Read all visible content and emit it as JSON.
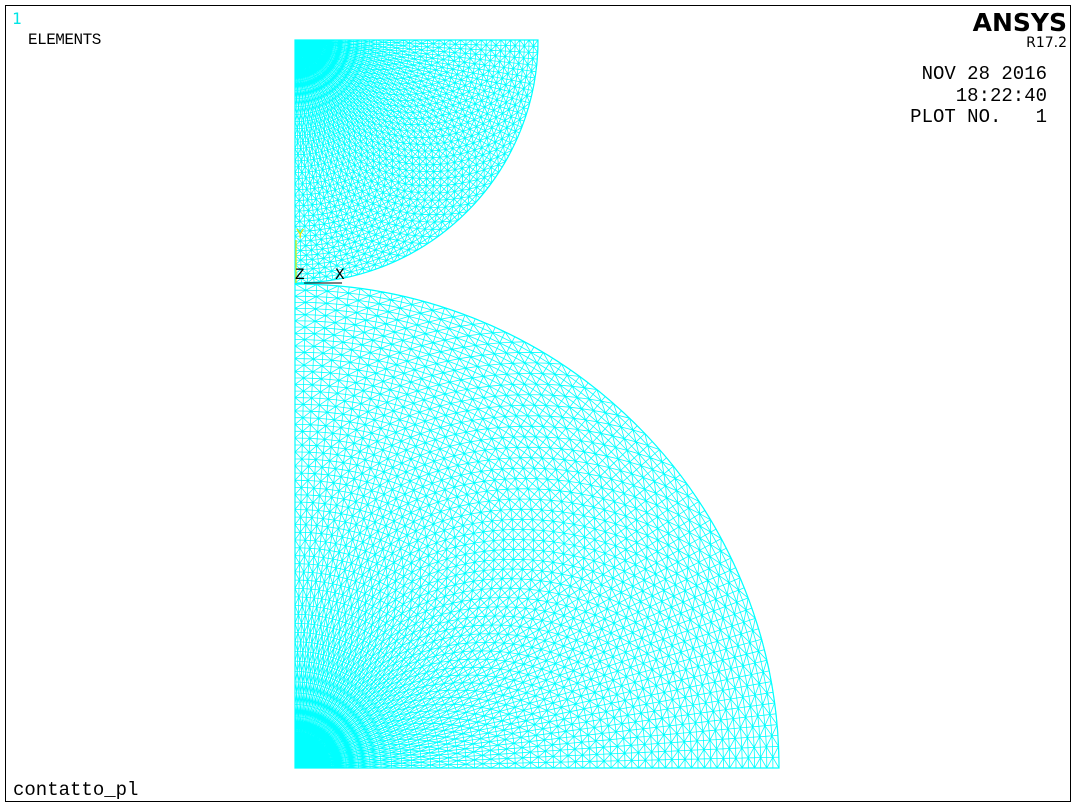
{
  "window": {
    "number": "1",
    "plot_label": "ELEMENTS",
    "jobname": "contatto_pl"
  },
  "header": {
    "brand": "ANSYS",
    "version": "R17.2",
    "date": "NOV 28 2016",
    "time": "18:22:40",
    "plot_no": "PLOT NO.   1"
  },
  "triad": {
    "z_label": "Z",
    "x_label": "X",
    "y_label": "Y"
  },
  "colors": {
    "mesh": "#00ffff",
    "triad_y": "#e5e500",
    "background": "#ffffff",
    "text": "#000000",
    "window_number": "#00e5e5"
  }
}
